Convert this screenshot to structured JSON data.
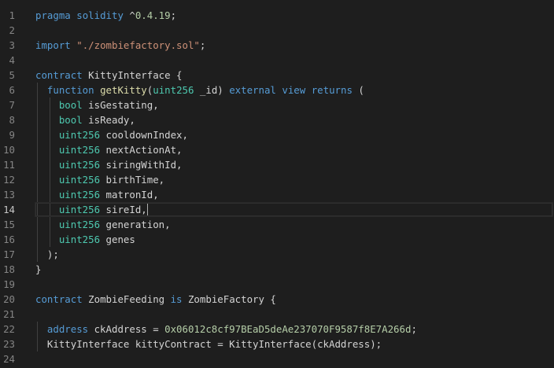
{
  "theme": {
    "background": "#1e1e1e",
    "keyword": "#569cd6",
    "type": "#4ec9b0",
    "string": "#ce9178",
    "number": "#b5cea8",
    "function": "#dcdcaa",
    "text": "#d4d4d4",
    "line_number": "#858585"
  },
  "editor": {
    "active_line": 14,
    "lines": [
      {
        "n": "1",
        "tokens": [
          [
            "kw",
            "pragma"
          ],
          [
            "tx",
            " "
          ],
          [
            "kw",
            "solidity"
          ],
          [
            "tx",
            " ^"
          ],
          [
            "num",
            "0.4.19"
          ],
          [
            "tx",
            ";"
          ]
        ]
      },
      {
        "n": "2",
        "tokens": []
      },
      {
        "n": "3",
        "tokens": [
          [
            "kw",
            "import"
          ],
          [
            "tx",
            " "
          ],
          [
            "str",
            "\"./zombiefactory.sol\""
          ],
          [
            "tx",
            ";"
          ]
        ]
      },
      {
        "n": "4",
        "tokens": []
      },
      {
        "n": "5",
        "tokens": [
          [
            "kw",
            "contract"
          ],
          [
            "tx",
            " KittyInterface {"
          ]
        ]
      },
      {
        "n": "6",
        "tokens": [
          [
            "tx",
            "  "
          ],
          [
            "kw",
            "function"
          ],
          [
            "tx",
            " "
          ],
          [
            "fn",
            "getKitty"
          ],
          [
            "tx",
            "("
          ],
          [
            "ty",
            "uint256"
          ],
          [
            "tx",
            " _id) "
          ],
          [
            "kw",
            "external"
          ],
          [
            "tx",
            " "
          ],
          [
            "kw",
            "view"
          ],
          [
            "tx",
            " "
          ],
          [
            "kw",
            "returns"
          ],
          [
            "tx",
            " ("
          ]
        ]
      },
      {
        "n": "7",
        "tokens": [
          [
            "tx",
            "    "
          ],
          [
            "ty",
            "bool"
          ],
          [
            "tx",
            " isGestating,"
          ]
        ]
      },
      {
        "n": "8",
        "tokens": [
          [
            "tx",
            "    "
          ],
          [
            "ty",
            "bool"
          ],
          [
            "tx",
            " isReady,"
          ]
        ]
      },
      {
        "n": "9",
        "tokens": [
          [
            "tx",
            "    "
          ],
          [
            "ty",
            "uint256"
          ],
          [
            "tx",
            " cooldownIndex,"
          ]
        ]
      },
      {
        "n": "10",
        "tokens": [
          [
            "tx",
            "    "
          ],
          [
            "ty",
            "uint256"
          ],
          [
            "tx",
            " nextActionAt,"
          ]
        ]
      },
      {
        "n": "11",
        "tokens": [
          [
            "tx",
            "    "
          ],
          [
            "ty",
            "uint256"
          ],
          [
            "tx",
            " siringWithId,"
          ]
        ]
      },
      {
        "n": "12",
        "tokens": [
          [
            "tx",
            "    "
          ],
          [
            "ty",
            "uint256"
          ],
          [
            "tx",
            " birthTime,"
          ]
        ]
      },
      {
        "n": "13",
        "tokens": [
          [
            "tx",
            "    "
          ],
          [
            "ty",
            "uint256"
          ],
          [
            "tx",
            " matronId,"
          ]
        ]
      },
      {
        "n": "14",
        "tokens": [
          [
            "tx",
            "    "
          ],
          [
            "ty",
            "uint256"
          ],
          [
            "tx",
            " sireId,"
          ]
        ]
      },
      {
        "n": "15",
        "tokens": [
          [
            "tx",
            "    "
          ],
          [
            "ty",
            "uint256"
          ],
          [
            "tx",
            " generation,"
          ]
        ]
      },
      {
        "n": "16",
        "tokens": [
          [
            "tx",
            "    "
          ],
          [
            "ty",
            "uint256"
          ],
          [
            "tx",
            " genes"
          ]
        ]
      },
      {
        "n": "17",
        "tokens": [
          [
            "tx",
            "  );"
          ]
        ]
      },
      {
        "n": "18",
        "tokens": [
          [
            "tx",
            "}"
          ]
        ]
      },
      {
        "n": "19",
        "tokens": []
      },
      {
        "n": "20",
        "tokens": [
          [
            "kw",
            "contract"
          ],
          [
            "tx",
            " ZombieFeeding "
          ],
          [
            "kw",
            "is"
          ],
          [
            "tx",
            " ZombieFactory {"
          ]
        ]
      },
      {
        "n": "21",
        "tokens": []
      },
      {
        "n": "22",
        "tokens": [
          [
            "tx",
            "  "
          ],
          [
            "kw",
            "address"
          ],
          [
            "tx",
            " ckAddress = "
          ],
          [
            "num",
            "0x06012c8cf97BEaD5deAe237070F9587f8E7A266d"
          ],
          [
            "tx",
            ";"
          ]
        ]
      },
      {
        "n": "23",
        "tokens": [
          [
            "tx",
            "  KittyInterface kittyContract = KittyInterface(ckAddress);"
          ]
        ]
      },
      {
        "n": "24",
        "tokens": []
      }
    ]
  }
}
